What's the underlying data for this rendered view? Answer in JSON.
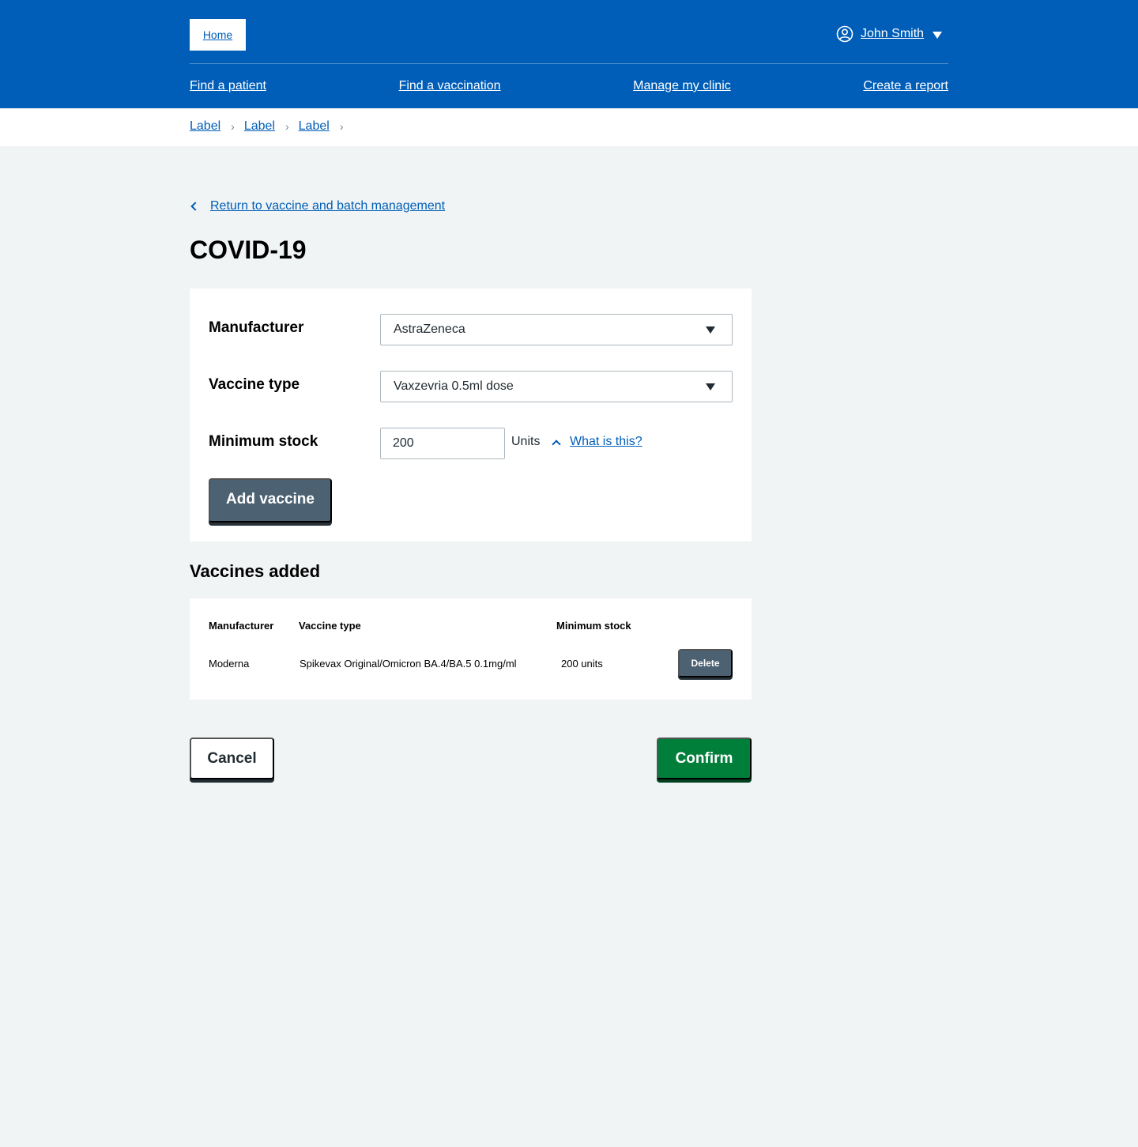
{
  "header": {
    "home_label": "Home",
    "user_name": "John Smith",
    "nav": [
      "Find a patient",
      "Find a vaccination",
      "Manage my clinic",
      "Create a report"
    ]
  },
  "breadcrumbs": [
    "Label",
    "Label",
    "Label"
  ],
  "back_link": "Return to vaccine and batch management",
  "page_title": "COVID-19",
  "form": {
    "manufacturer_label": "Manufacturer",
    "manufacturer_value": "AstraZeneca",
    "vaccine_type_label": "Vaccine type",
    "vaccine_type_value": "Vaxzevria 0.5ml dose",
    "min_stock_label": "Minimum stock",
    "min_stock_value": "200",
    "units_label": "Units",
    "what_is_this": "What is this?",
    "add_button": "Add vaccine"
  },
  "vaccines_added": {
    "title": "Vaccines added",
    "columns": [
      "Manufacturer",
      "Vaccine type",
      "Minimum stock"
    ],
    "rows": [
      {
        "manufacturer": "Moderna",
        "vaccine_type": "Spikevax Original/Omicron BA.4/BA.5 0.1mg/ml",
        "min_stock": "200 units",
        "action": "Delete"
      }
    ]
  },
  "actions": {
    "cancel": "Cancel",
    "confirm": "Confirm"
  },
  "colors": {
    "header_blue": "#005eb8",
    "confirm_green": "#007f3b",
    "secondary_button": "#4c6272",
    "page_background": "#f0f4f5"
  }
}
